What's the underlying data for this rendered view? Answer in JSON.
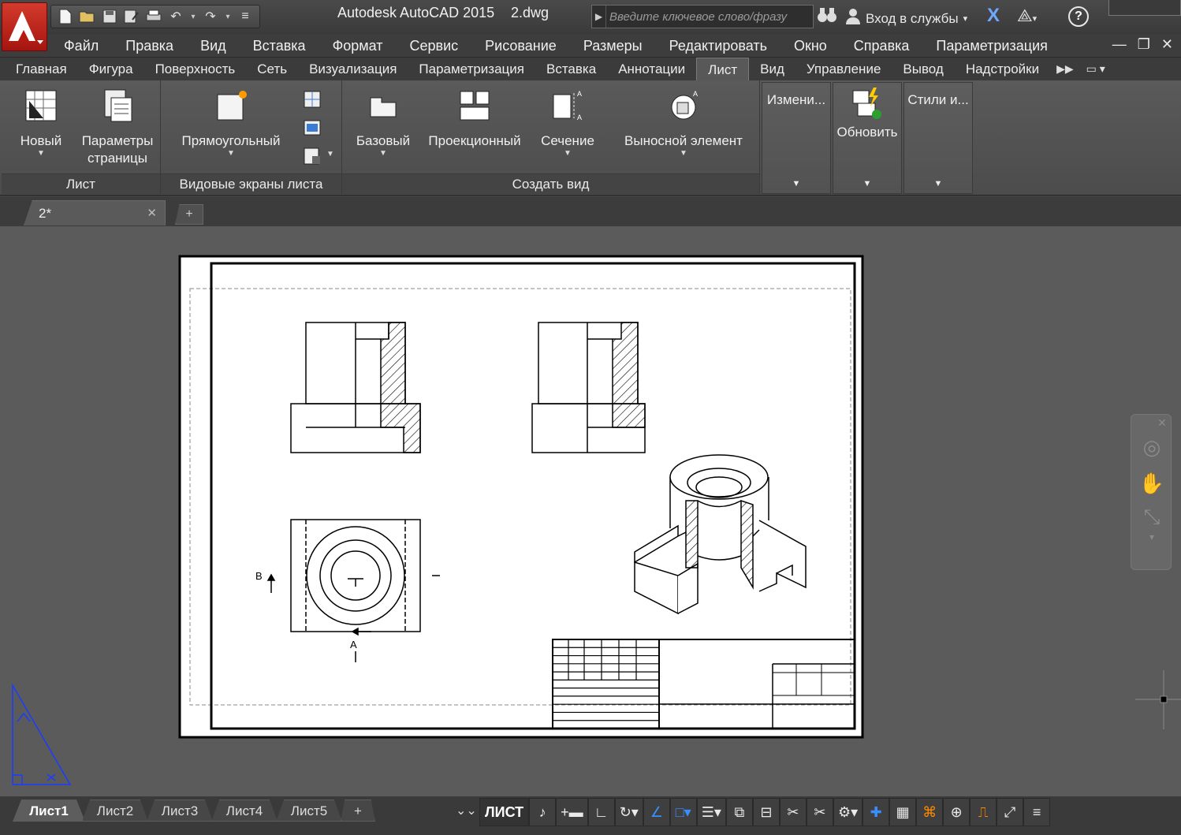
{
  "titlebar": {
    "app_name": "Autodesk AutoCAD 2015",
    "file_name": "2.dwg",
    "search_placeholder": "Введите ключевое слово/фразу",
    "signin_label": "Вход в службы"
  },
  "menu": [
    "Файл",
    "Правка",
    "Вид",
    "Вставка",
    "Формат",
    "Сервис",
    "Рисование",
    "Размеры",
    "Редактировать",
    "Окно",
    "Справка",
    "Параметризация"
  ],
  "ribbon_tabs": {
    "items": [
      "Главная",
      "Фигура",
      "Поверхность",
      "Сеть",
      "Визуализация",
      "Параметризация",
      "Вставка",
      "Аннотации",
      "Лист",
      "Вид",
      "Управление",
      "Вывод",
      "Надстройки"
    ],
    "active": "Лист"
  },
  "ribbon": {
    "panels": {
      "sheet": {
        "title": "Лист",
        "new_label": "Новый",
        "page_setup_label": "Параметры страницы"
      },
      "viewports": {
        "title": "Видовые экраны листа",
        "rect_label": "Прямоугольный"
      },
      "create_view": {
        "title": "Создать вид",
        "base_label": "Базовый",
        "projected_label": "Проекционный",
        "section_label": "Сечение",
        "detail_label": "Выносной элемент"
      },
      "modify": {
        "label": "Измени..."
      },
      "update": {
        "label": "Обновить"
      },
      "styles": {
        "label": "Стили и..."
      }
    }
  },
  "document_tab": {
    "label": "2*"
  },
  "drawing": {
    "section_label_b": "B",
    "section_label_a": "A",
    "section_mark": "I"
  },
  "layout_tabs": {
    "items": [
      "Лист1",
      "Лист2",
      "Лист3",
      "Лист4",
      "Лист5"
    ],
    "active": "Лист1"
  },
  "statusbar": {
    "mode_label": "ЛИСТ"
  },
  "colors": {
    "app_red": "#c1261b",
    "ucs_blue": "#1a3cff",
    "accent_blue": "#3a8fff"
  }
}
